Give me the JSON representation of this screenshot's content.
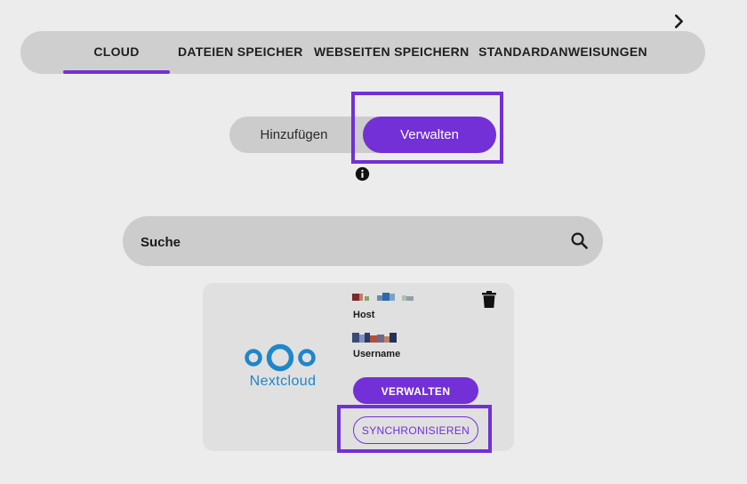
{
  "tabs": [
    {
      "label": "CLOUD",
      "active": true
    },
    {
      "label": "DATEIEN SPEICHER",
      "active": false
    },
    {
      "label": "WEBSEITEN SPEICHERN",
      "active": false
    },
    {
      "label": "STANDARDANWEISUNGEN",
      "active": false
    }
  ],
  "mode_toggle": {
    "add_label": "Hinzufügen",
    "manage_label": "Verwalten",
    "selected": "Verwalten"
  },
  "search": {
    "placeholder": "Suche",
    "value": ""
  },
  "account_card": {
    "service_name": "Nextcloud",
    "logo_text": "Nextcloud",
    "host_label": "Host",
    "host_value_redacted": true,
    "username_label": "Username",
    "username_value_redacted": true,
    "manage_button": "VERWALTEN",
    "sync_button": "SYNCHRONISIEREN"
  },
  "colors": {
    "accent": "#7230d6",
    "nextcloud_blue": "#1f86c8",
    "background": "#ececec"
  },
  "icons": [
    "chevron-right-icon",
    "info-icon",
    "search-icon",
    "trash-icon",
    "nextcloud-logo"
  ]
}
